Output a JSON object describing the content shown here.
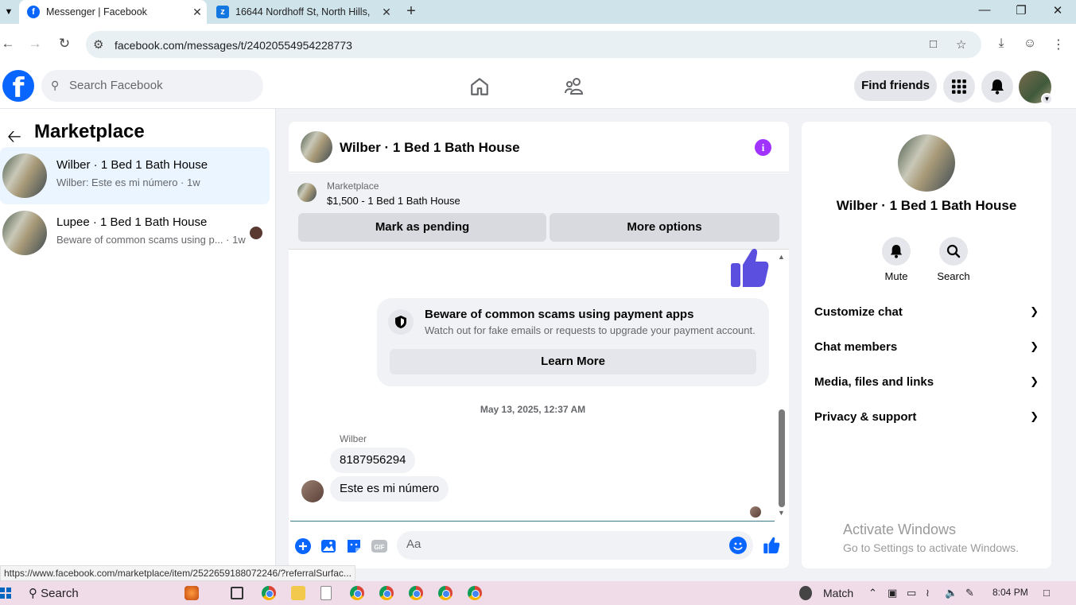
{
  "browser": {
    "tabs": [
      {
        "title": "Messenger | Facebook",
        "active": true
      },
      {
        "title": "16644 Nordhoff St, North Hills,",
        "active": false
      }
    ],
    "url": "facebook.com/messages/t/24020554954228773"
  },
  "fb": {
    "search_placeholder": "Search Facebook",
    "find_friends": "Find friends"
  },
  "left": {
    "title": "Marketplace",
    "conversations": [
      {
        "name": "Wilber · 1 Bed 1 Bath House",
        "snippet": "Wilber: Este es mi número · 1w",
        "selected": true
      },
      {
        "name": "Lupee · 1 Bed 1 Bath House",
        "snippet": "Beware of common scams using p... · 1w",
        "selected": false
      }
    ]
  },
  "chat": {
    "title": "Wilber · 1 Bed 1 Bath House",
    "listing": {
      "category": "Marketplace",
      "title": "$1,500 - 1 Bed 1 Bath House",
      "mark_pending": "Mark as pending",
      "more_options": "More options"
    },
    "scam_notice": {
      "title": "Beware of common scams using payment apps",
      "body": "Watch out for fake emails or requests to upgrade your payment account.",
      "button": "Learn More"
    },
    "timestamp": "May 13, 2025, 12:37 AM",
    "sender": "Wilber",
    "messages": [
      "8187956294",
      "Este es mi número"
    ],
    "composer_placeholder": "Aa"
  },
  "right": {
    "name": "Wilber · 1 Bed 1 Bath House",
    "actions": [
      {
        "label": "Mute",
        "icon": "bell-icon"
      },
      {
        "label": "Search",
        "icon": "search-icon"
      }
    ],
    "sections": [
      "Customize chat",
      "Chat members",
      "Media, files and links",
      "Privacy & support"
    ]
  },
  "watermark": {
    "line1": "Activate Windows",
    "line2": "Go to Settings to activate Windows."
  },
  "status_url": "https://www.facebook.com/marketplace/item/2522659188072246/?referralSurfac...",
  "taskbar": {
    "search": "Search",
    "weather": "Match",
    "time": "8:04 PM"
  },
  "colors": {
    "fb_blue": "#0866ff",
    "info_purple": "#a033ff",
    "thumb_purple": "#5b4fe0"
  }
}
